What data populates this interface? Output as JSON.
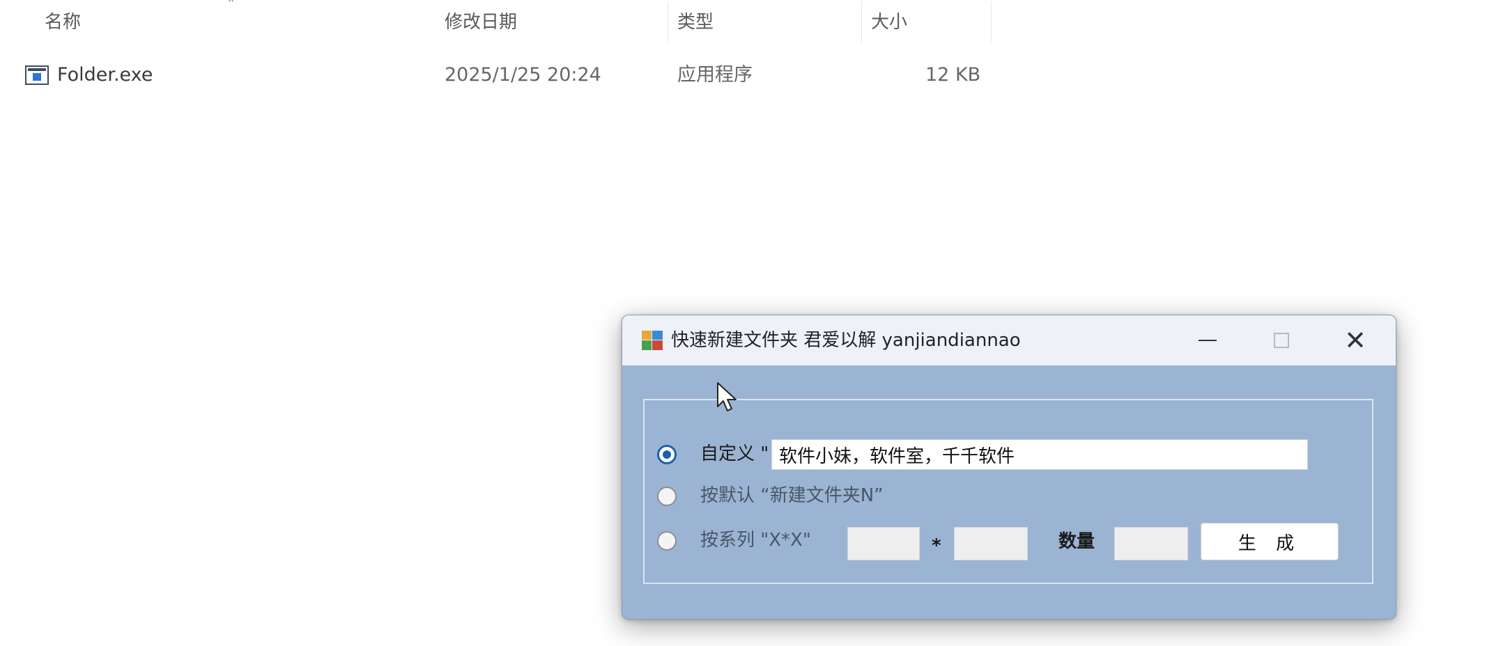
{
  "explorer": {
    "columns": {
      "name": "名称",
      "modified": "修改日期",
      "type": "类型",
      "size": "大小"
    },
    "file": {
      "icon": "exe-file-icon",
      "name": "Folder.exe",
      "modified": "2025/1/25 20:24",
      "type": "应用程序",
      "size": "12 KB"
    }
  },
  "dialog": {
    "title": "快速新建文件夹 君爱以解 yanjiandiannao",
    "options": {
      "custom_label": "自定义 \"，\"",
      "custom_value": "软件小妹，软件室，千千软件",
      "default_label": "按默认 “新建文件夹N”",
      "series_label": "按系列 \"X*X\"",
      "times_symbol": "*",
      "count_label": "数量",
      "series_a_value": "",
      "series_b_value": "",
      "count_value": ""
    },
    "selected_option": "custom",
    "generate_button": "生 成",
    "window_controls": {
      "minimize": "minimize-icon",
      "maximize": "maximize-icon",
      "close": "✕"
    }
  },
  "colors": {
    "dialog_bg": "#9bb4d3",
    "titlebar_bg": "#eef2f8",
    "radio_accent": "#1f5fa8"
  }
}
